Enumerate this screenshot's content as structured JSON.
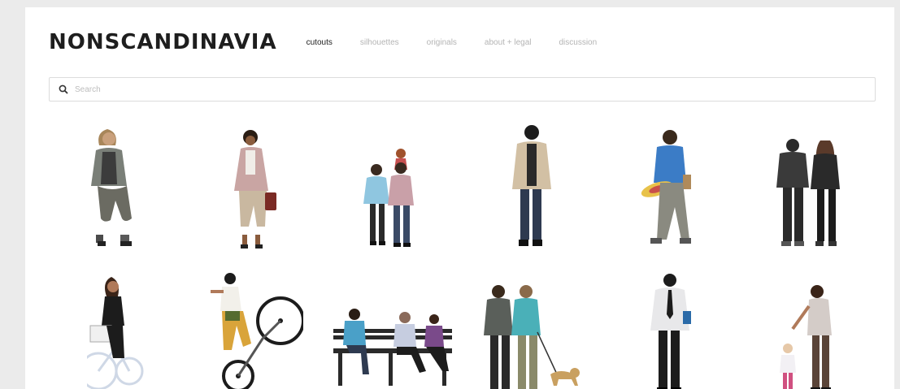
{
  "site": {
    "logo": "NONSCANDINAVIA"
  },
  "nav": [
    {
      "label": "cutouts",
      "active": true
    },
    {
      "label": "silhouettes",
      "active": false
    },
    {
      "label": "originals",
      "active": false
    },
    {
      "label": "about + legal",
      "active": false
    },
    {
      "label": "discussion",
      "active": false
    }
  ],
  "search": {
    "placeholder": "Search",
    "value": "",
    "icon": "search-icon"
  },
  "gallery": {
    "rows": [
      [
        "person-walking-long-hair",
        "woman-walking-with-bag",
        "family-with-child",
        "man-walking-jacket",
        "boy-with-skateboard",
        "couple-walking-away"
      ],
      [
        "woman-on-bicycle",
        "man-bmx-wheelie",
        "people-on-bench",
        "couple-with-dog",
        "man-in-tie",
        "woman-with-toddler"
      ]
    ]
  },
  "colors": {
    "background": "#ebebeb",
    "page": "#ffffff",
    "text": "#1e1e1e",
    "muted": "#b4b4b4"
  }
}
